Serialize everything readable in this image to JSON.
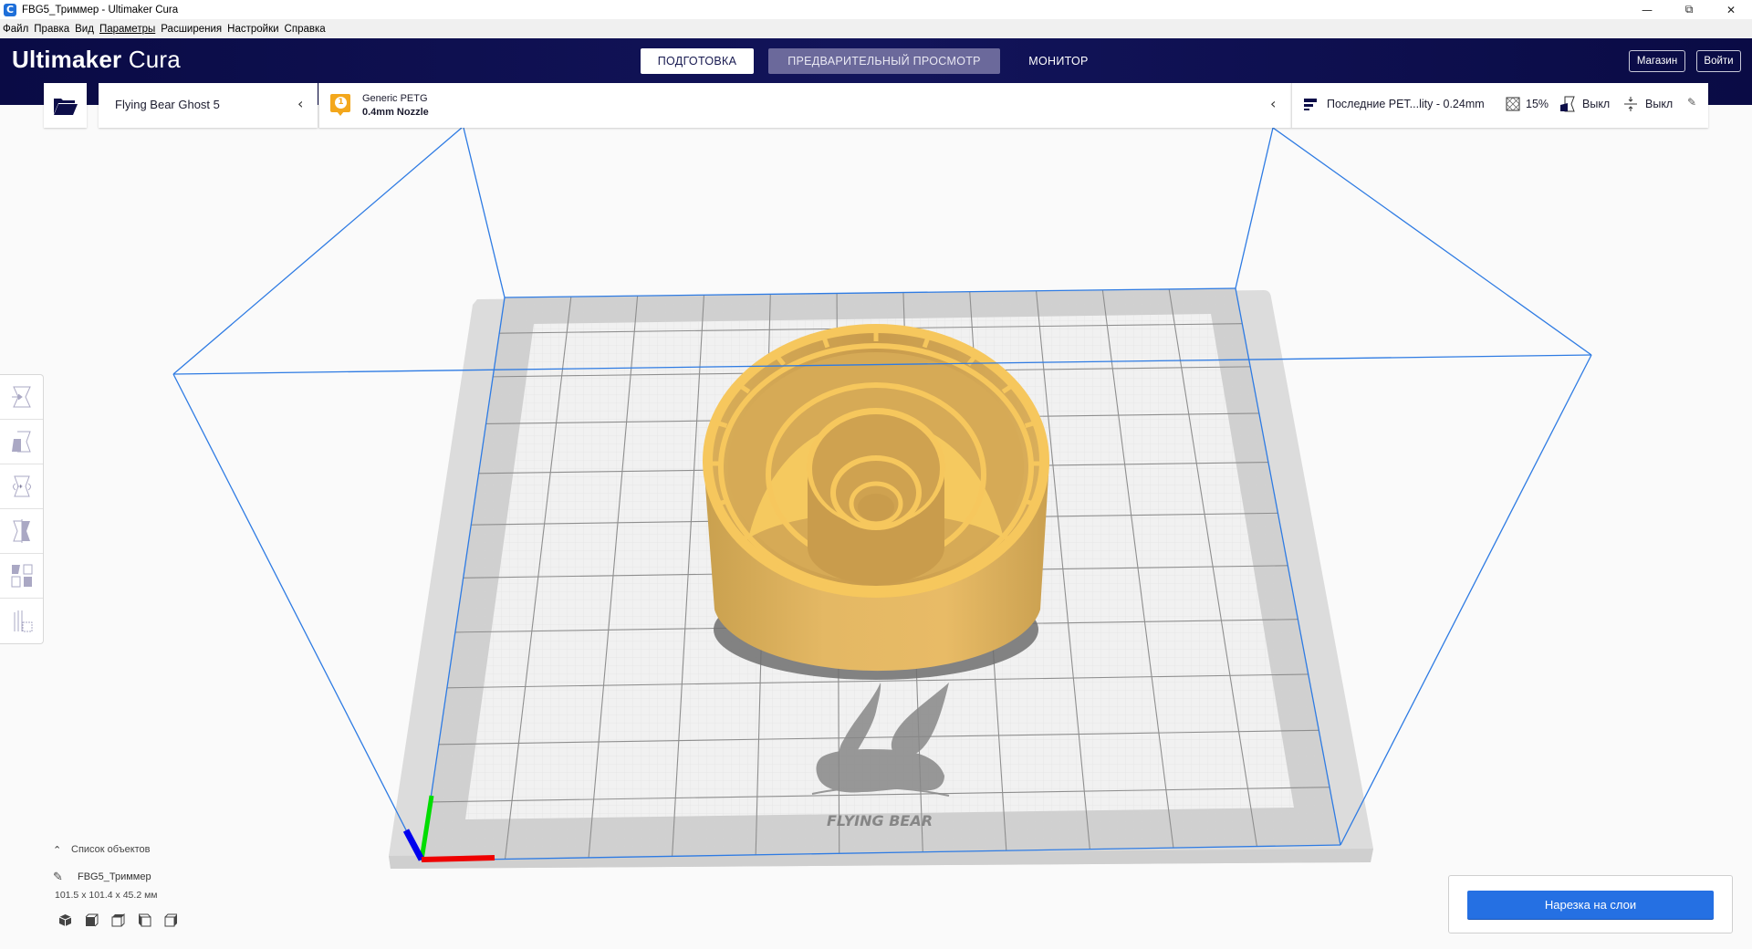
{
  "window": {
    "title": "FBG5_Триммер - Ultimaker Cura",
    "app_icon": "cura-icon",
    "controls": [
      "minimize-icon",
      "restore-icon",
      "close-icon"
    ]
  },
  "menu": {
    "items": [
      "Файл",
      "Правка",
      "Вид",
      "Параметры",
      "Расширения",
      "Настройки",
      "Справка"
    ]
  },
  "header": {
    "logo_bold": "Ultimaker",
    "logo_light": " Cura",
    "tabs": [
      {
        "label": "ПОДГОТОВКА",
        "state": "active"
      },
      {
        "label": "ПРЕДВАРИТЕЛЬНЫЙ ПРОСМОТР",
        "state": "hover"
      },
      {
        "label": "МОНИТОР",
        "state": "normal"
      }
    ],
    "marketplace_label": "Магазин",
    "signin_label": "Войти",
    "colors": {
      "bg": "#0d0e49",
      "tab_hover": "#6c6a9c",
      "tab_active": "#ffffff"
    }
  },
  "toolbar": {
    "open_icon": "folder-icon",
    "printer": {
      "name": "Flying Bear Ghost 5",
      "chevron": "chevron-left-icon"
    },
    "extruder": {
      "badge": "1",
      "material": "Generic PETG",
      "nozzle": "0.4mm Nozzle",
      "badge_color": "#f3a71c"
    },
    "print_settings": {
      "profile": "Последние PET...lity - 0.24mm",
      "infill": "15%",
      "support": "Выкл",
      "adhesion": "Выкл"
    }
  },
  "tools": {
    "items": [
      "move-tool",
      "scale-tool",
      "rotate-tool",
      "mirror-tool",
      "per-model-settings-tool",
      "support-blocker-tool"
    ]
  },
  "object_list": {
    "header": "Список объектов",
    "object_name": "FBG5_Триммер",
    "dimensions": "101.5 x 101.4 x 45.2 мм",
    "view_buttons": [
      "view-3d",
      "view-front",
      "view-top",
      "view-left",
      "view-right"
    ]
  },
  "scene": {
    "printer_bed_brand": "FLYING BEAR",
    "model_color": "#f7c55b",
    "volume_line_color": "#2e7be3"
  },
  "slice": {
    "button_label": "Нарезка на слои"
  }
}
